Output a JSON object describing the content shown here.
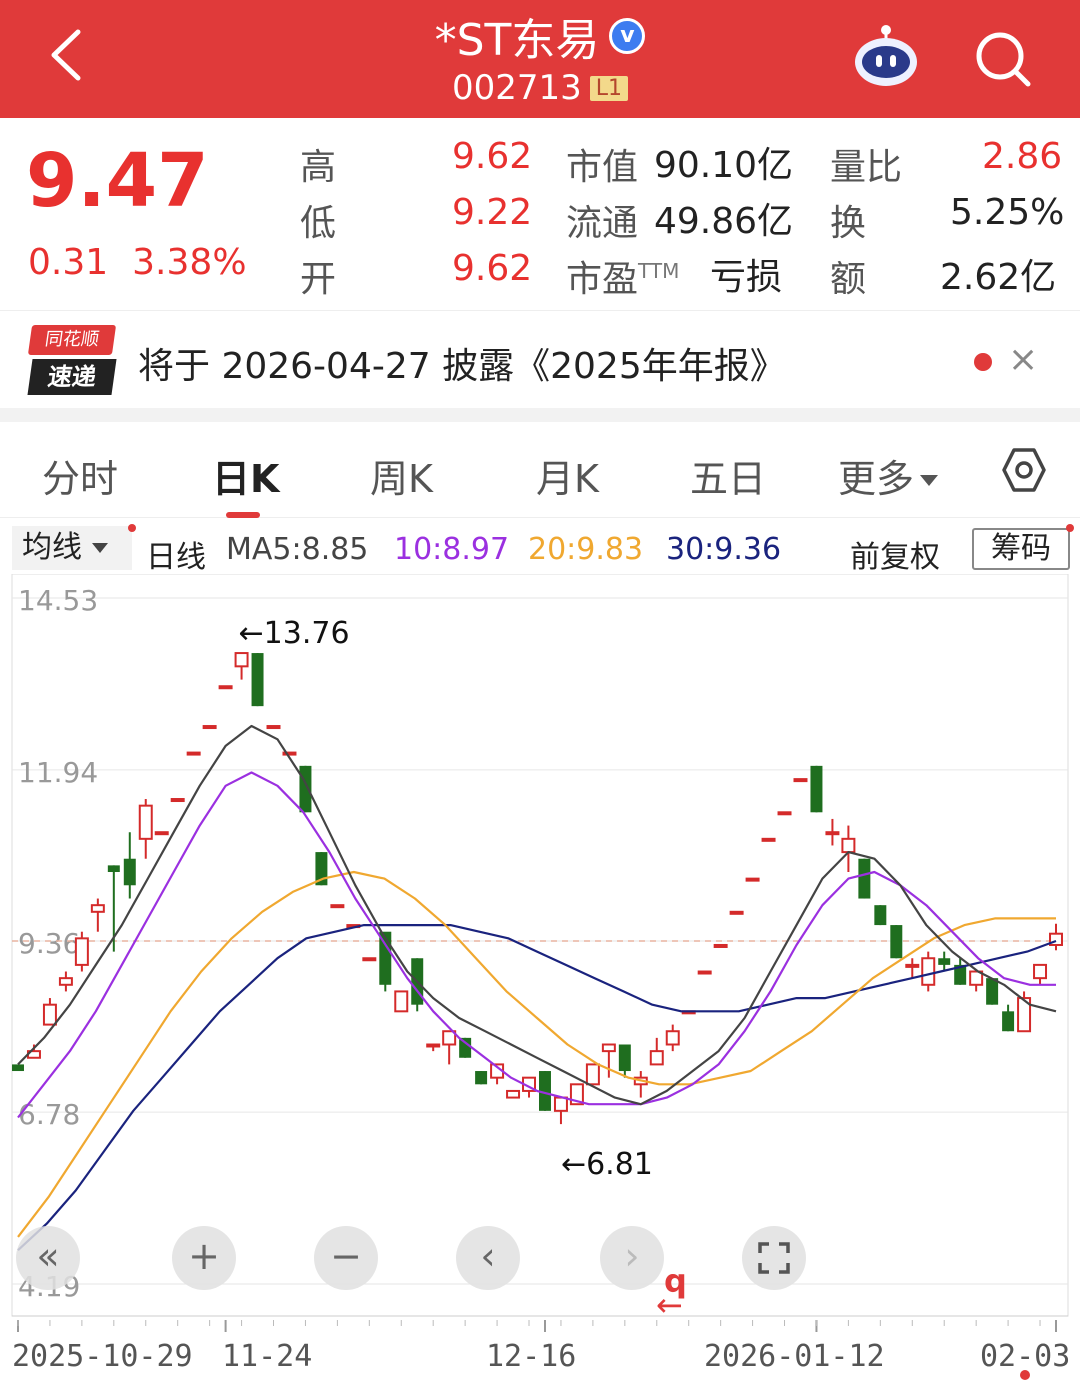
{
  "header": {
    "title": "*ST东易",
    "verified_mark": "v",
    "code": "002713",
    "level": "L1",
    "icons": [
      "back-icon",
      "robot-assistant-icon",
      "search-icon"
    ],
    "color": "#e03a3a"
  },
  "quote": {
    "price": "9.47",
    "change": "0.31",
    "change_pct": "3.38%",
    "high_label": "高",
    "high": "9.62",
    "low_label": "低",
    "low": "9.22",
    "open_label": "开",
    "open": "9.62",
    "mcap_label": "市值",
    "mcap": "90.10亿",
    "float_label": "流通",
    "float": "49.86亿",
    "pe_label": "市盈",
    "pe_sup": "TTM",
    "pe": "亏损",
    "vol_ratio_label": "量比",
    "vol_ratio": "2.86",
    "turnover_label": "换",
    "turnover": "5.25%",
    "amount_label": "额",
    "amount": "2.62亿"
  },
  "news": {
    "logo_top": "同花顺",
    "logo_bottom": "速递",
    "text": "将于 2026-04-27 披露《2025年年报》",
    "close": "×"
  },
  "tabs": [
    {
      "label": "分时"
    },
    {
      "label": "日K"
    },
    {
      "label": "周K"
    },
    {
      "label": "月K"
    },
    {
      "label": "五日"
    },
    {
      "label": "更多"
    }
  ],
  "ma_bar": {
    "select": "均线",
    "period": "日线",
    "ma5": "MA5:8.85",
    "ma10": "10:8.97",
    "ma20": "20:9.83",
    "ma30": "30:9.36",
    "adjust": "前复权",
    "chips": "筹码",
    "colors": {
      "ma5": "#444444",
      "ma10": "#9b30e0",
      "ma20": "#f0a830",
      "ma30": "#1a237e"
    }
  },
  "chart_data": {
    "type": "candlestick",
    "y_ticks": [
      "14.53",
      "11.94",
      "9.36",
      "6.78",
      "4.19"
    ],
    "x_ticks": [
      "2025-10-29",
      "11-24",
      "12-16",
      "2026-01-12",
      "02-03"
    ],
    "high_annotation": "←13.76",
    "low_annotation": "←6.81",
    "reference_line": 9.36,
    "ylim": [
      4.19,
      14.53
    ],
    "candles": [
      [
        7.5,
        7.4,
        7.4,
        7.4
      ],
      [
        7.6,
        7.7,
        7.6,
        7.8
      ],
      [
        8.1,
        8.4,
        8.1,
        8.5
      ],
      [
        8.7,
        8.8,
        8.6,
        8.9
      ],
      [
        9.0,
        9.4,
        8.9,
        9.5
      ],
      [
        9.8,
        9.9,
        9.5,
        10.0
      ],
      [
        10.5,
        10.4,
        9.2,
        10.5
      ],
      [
        10.6,
        10.2,
        10.0,
        11.0
      ],
      [
        10.9,
        11.4,
        10.6,
        11.5
      ],
      [
        11.0,
        11.0,
        11.0,
        11.0
      ],
      [
        11.5,
        11.5,
        11.5,
        11.5
      ],
      [
        12.2,
        12.2,
        12.2,
        12.2
      ],
      [
        12.6,
        12.6,
        12.6,
        12.6
      ],
      [
        13.2,
        13.2,
        13.2,
        13.2
      ],
      [
        13.5,
        13.7,
        13.3,
        13.7
      ],
      [
        13.7,
        12.9,
        12.9,
        13.7
      ],
      [
        12.6,
        12.6,
        12.6,
        12.6
      ],
      [
        12.2,
        12.2,
        12.2,
        12.2
      ],
      [
        12.0,
        11.3,
        11.3,
        12.0
      ],
      [
        10.7,
        10.2,
        10.2,
        10.7
      ],
      [
        9.9,
        9.9,
        9.9,
        9.9
      ],
      [
        9.6,
        9.6,
        9.6,
        9.6
      ],
      [
        9.1,
        9.1,
        9.1,
        9.1
      ],
      [
        9.5,
        8.7,
        8.6,
        9.4
      ],
      [
        8.3,
        8.6,
        8.3,
        8.6
      ],
      [
        9.1,
        8.4,
        8.3,
        9.1
      ],
      [
        7.8,
        7.8,
        7.7,
        7.8
      ],
      [
        7.8,
        8.0,
        7.5,
        8.0
      ],
      [
        7.9,
        7.6,
        7.6,
        7.9
      ],
      [
        7.4,
        7.2,
        7.2,
        7.4
      ],
      [
        7.3,
        7.5,
        7.2,
        7.5
      ],
      [
        7.0,
        7.1,
        7.0,
        7.1
      ],
      [
        7.1,
        7.3,
        7.0,
        7.3
      ],
      [
        7.4,
        6.8,
        6.8,
        7.4
      ],
      [
        6.8,
        7.0,
        6.6,
        7.0
      ],
      [
        6.9,
        7.2,
        6.9,
        7.2
      ],
      [
        7.2,
        7.5,
        7.2,
        7.5
      ],
      [
        7.7,
        7.8,
        7.3,
        7.8
      ],
      [
        7.8,
        7.4,
        7.3,
        7.8
      ],
      [
        7.2,
        7.3,
        7.0,
        7.4
      ],
      [
        7.5,
        7.7,
        7.5,
        7.9
      ],
      [
        7.8,
        8.0,
        7.7,
        8.1
      ],
      [
        8.3,
        8.3,
        8.3,
        8.3
      ],
      [
        8.9,
        8.9,
        8.9,
        8.9
      ],
      [
        9.3,
        9.3,
        9.3,
        9.3
      ],
      [
        9.8,
        9.8,
        9.8,
        9.8
      ],
      [
        10.3,
        10.3,
        10.3,
        10.3
      ],
      [
        10.9,
        10.9,
        10.9,
        10.9
      ],
      [
        11.3,
        11.3,
        11.3,
        11.3
      ],
      [
        11.8,
        11.8,
        11.8,
        11.8
      ],
      [
        12.0,
        11.3,
        11.3,
        12.0
      ],
      [
        11.0,
        11.0,
        10.8,
        11.2
      ],
      [
        10.7,
        10.9,
        10.4,
        11.1
      ],
      [
        10.6,
        10.0,
        10.0,
        10.6
      ],
      [
        9.9,
        9.6,
        9.6,
        9.9
      ],
      [
        9.6,
        9.1,
        9.1,
        9.6
      ],
      [
        9.0,
        9.0,
        8.8,
        9.1
      ],
      [
        8.7,
        9.1,
        8.6,
        9.2
      ],
      [
        9.1,
        9.0,
        8.9,
        9.2
      ],
      [
        9.0,
        8.7,
        8.7,
        9.1
      ],
      [
        8.7,
        8.9,
        8.6,
        8.9
      ],
      [
        8.8,
        8.4,
        8.4,
        8.8
      ],
      [
        8.3,
        8.0,
        8.0,
        8.4
      ],
      [
        8.0,
        8.5,
        8.0,
        8.6
      ],
      [
        8.8,
        9.0,
        8.7,
        9.0
      ],
      [
        9.3,
        9.47,
        9.22,
        9.62
      ]
    ],
    "ma5": [
      7.5,
      7.9,
      8.4,
      9.0,
      9.6,
      10.3,
      11.0,
      11.7,
      12.3,
      12.6,
      12.4,
      11.8,
      11.0,
      10.2,
      9.5,
      8.9,
      8.5,
      8.2,
      8.0,
      7.8,
      7.6,
      7.4,
      7.2,
      7.0,
      6.9,
      7.1,
      7.4,
      7.7,
      8.2,
      8.9,
      9.6,
      10.3,
      10.7,
      10.6,
      10.2,
      9.6,
      9.2,
      8.9,
      8.7,
      8.4,
      8.3
    ],
    "ma10": [
      6.7,
      7.2,
      7.7,
      8.3,
      9.0,
      9.7,
      10.4,
      11.1,
      11.7,
      11.9,
      11.7,
      11.3,
      10.7,
      10.0,
      9.4,
      8.8,
      8.3,
      7.9,
      7.6,
      7.3,
      7.1,
      7.0,
      6.9,
      6.9,
      6.9,
      7.0,
      7.2,
      7.5,
      8.0,
      8.6,
      9.3,
      9.9,
      10.3,
      10.4,
      10.2,
      9.9,
      9.5,
      9.1,
      8.8,
      8.7,
      8.7
    ],
    "ma20": [
      4.9,
      5.5,
      6.2,
      6.9,
      7.6,
      8.3,
      8.9,
      9.4,
      9.8,
      10.1,
      10.3,
      10.4,
      10.3,
      10.0,
      9.6,
      9.1,
      8.6,
      8.2,
      7.8,
      7.5,
      7.3,
      7.2,
      7.2,
      7.3,
      7.4,
      7.7,
      8.0,
      8.4,
      8.8,
      9.1,
      9.4,
      9.6,
      9.7,
      9.7,
      9.7
    ],
    "ma30": [
      4.7,
      5.1,
      5.6,
      6.2,
      6.8,
      7.3,
      7.8,
      8.3,
      8.7,
      9.1,
      9.4,
      9.5,
      9.6,
      9.6,
      9.6,
      9.6,
      9.5,
      9.4,
      9.2,
      9.0,
      8.8,
      8.6,
      8.4,
      8.3,
      8.3,
      8.3,
      8.4,
      8.5,
      8.5,
      8.6,
      8.7,
      8.8,
      8.9,
      9.0,
      9.1,
      9.2,
      9.36
    ],
    "colors": {
      "up": "#d42a2a",
      "down": "#1f6e1f",
      "grid": "#e6e6e6",
      "ref": "#e8b4a0"
    }
  },
  "chart_controls": [
    {
      "icon": "fast-back-icon",
      "glyph": "«"
    },
    {
      "icon": "zoom-in-icon",
      "glyph": "+"
    },
    {
      "icon": "zoom-out-icon",
      "glyph": "−"
    },
    {
      "icon": "prev-icon",
      "glyph": "‹"
    },
    {
      "icon": "next-icon",
      "glyph": "›"
    },
    {
      "icon": "fullscreen-icon",
      "glyph": ""
    }
  ],
  "marker": {
    "label": "q",
    "arrow": "←"
  }
}
